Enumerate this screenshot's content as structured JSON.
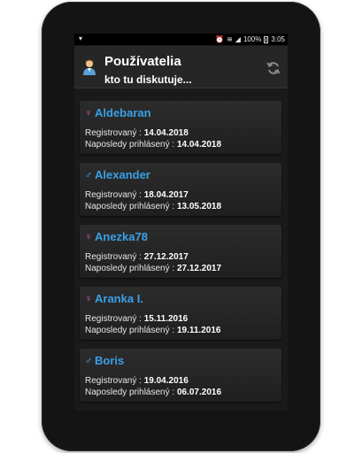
{
  "status_bar": {
    "battery": "100%",
    "time": "3:05"
  },
  "header": {
    "title": "Používatelia",
    "subtitle": "kto tu diskutuje..."
  },
  "labels": {
    "registered": "Registrovaný : ",
    "last_login": "Naposledy prihlásený : "
  },
  "users": [
    {
      "name": "Aldebaran",
      "gender": "female",
      "symbol": "♀",
      "registered": "14.04.2018",
      "last_login": "14.04.2018"
    },
    {
      "name": "Alexander",
      "gender": "male",
      "symbol": "♂",
      "registered": "18.04.2017",
      "last_login": "13.05.2018"
    },
    {
      "name": "Anezka78",
      "gender": "female",
      "symbol": "♀",
      "registered": "27.12.2017",
      "last_login": "27.12.2017"
    },
    {
      "name": "Aranka I.",
      "gender": "female",
      "symbol": "♀",
      "registered": "15.11.2016",
      "last_login": "19.11.2016"
    },
    {
      "name": "Boris",
      "gender": "male",
      "symbol": "♂",
      "registered": "19.04.2016",
      "last_login": "06.07.2016"
    }
  ],
  "colors": {
    "name": "#3aa0e6",
    "female": "#e85ec9",
    "male": "#4ab3f5"
  }
}
